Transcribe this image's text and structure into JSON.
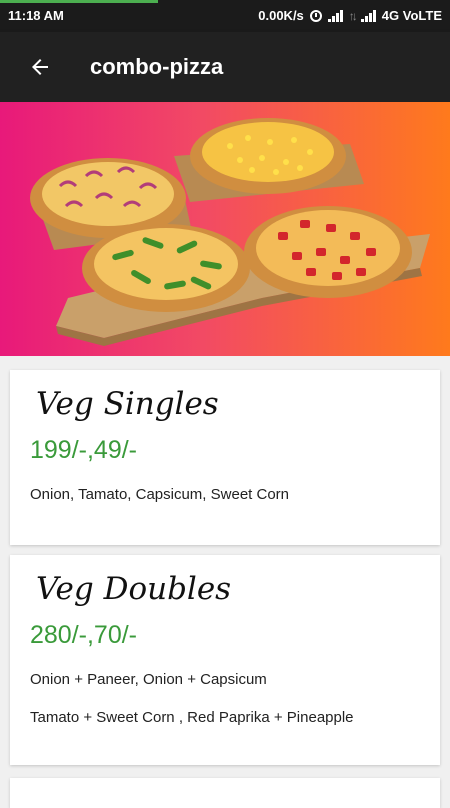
{
  "status_bar": {
    "time": "11:18 AM",
    "speed": "0.00K/s",
    "network": "4G VoLTE"
  },
  "app_bar": {
    "title": "combo-pizza",
    "back_icon": "arrow-left-icon"
  },
  "hero": {
    "image": "pizza-combo-photo",
    "colors": {
      "gradient_start": "#e8197a",
      "gradient_end": "#ff7a1c"
    }
  },
  "cards": [
    {
      "title": "Veg Singles",
      "price": "199/-,49/-",
      "lines": [
        "Onion, Tamato, Capsicum, Sweet Corn"
      ]
    },
    {
      "title": "Veg Doubles",
      "price": "280/-,70/-",
      "lines": [
        "Onion + Paneer, Onion + Capsicum",
        "Tamato + Sweet Corn , Red Paprika + Pineapple"
      ]
    }
  ],
  "colors": {
    "price": "#3a9a3a",
    "app_bar": "#212121"
  }
}
